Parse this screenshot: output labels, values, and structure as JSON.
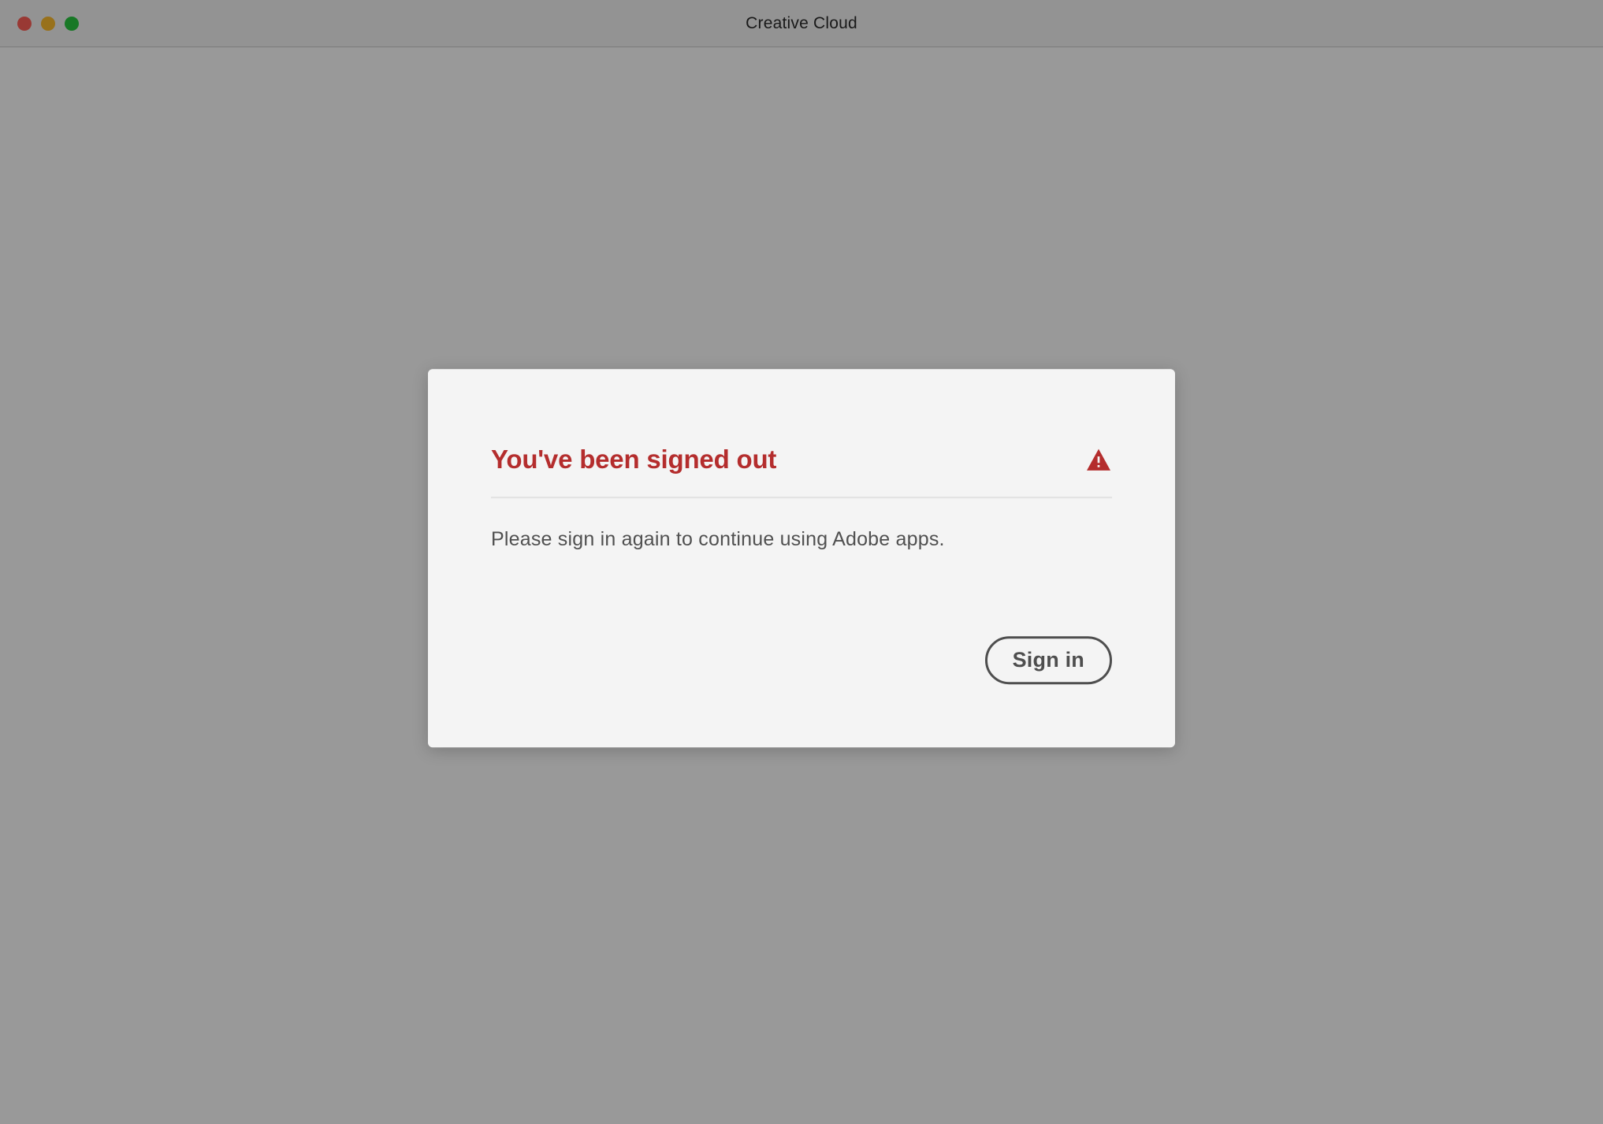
{
  "window": {
    "title": "Creative Cloud"
  },
  "modal": {
    "title": "You've been signed out",
    "body": "Please sign in again to continue using Adobe apps.",
    "button_label": "Sign in"
  },
  "colors": {
    "alert_red": "#B42D2D",
    "button_border": "#4E4E4E"
  }
}
